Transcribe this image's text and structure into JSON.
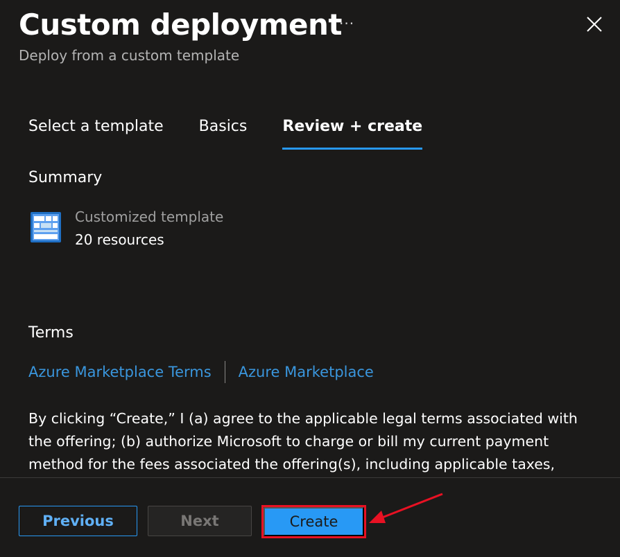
{
  "header": {
    "title": "Custom deployment",
    "subtitle": "Deploy from a custom template",
    "more_label": "···",
    "close_icon": "close-icon"
  },
  "tabs": [
    {
      "label": "Select a template",
      "active": false
    },
    {
      "label": "Basics",
      "active": false
    },
    {
      "label": "Review + create",
      "active": true
    }
  ],
  "summary": {
    "heading": "Summary",
    "template_icon": "template-grid-icon",
    "template_name": "Customized template",
    "resource_count": "20 resources"
  },
  "terms": {
    "heading": "Terms",
    "links": [
      "Azure Marketplace Terms",
      "Azure Marketplace"
    ],
    "legal_text": "By clicking “Create,” I (a) agree to the applicable legal terms associated with the offering; (b) authorize Microsoft to charge or bill my current payment method for the fees associated the offering(s), including applicable taxes,"
  },
  "footer": {
    "previous_label": "Previous",
    "next_label": "Next",
    "create_label": "Create"
  },
  "colors": {
    "background": "#1b1a19",
    "accent": "#2899f5",
    "link": "#3a96dd",
    "highlight": "#e81123"
  }
}
